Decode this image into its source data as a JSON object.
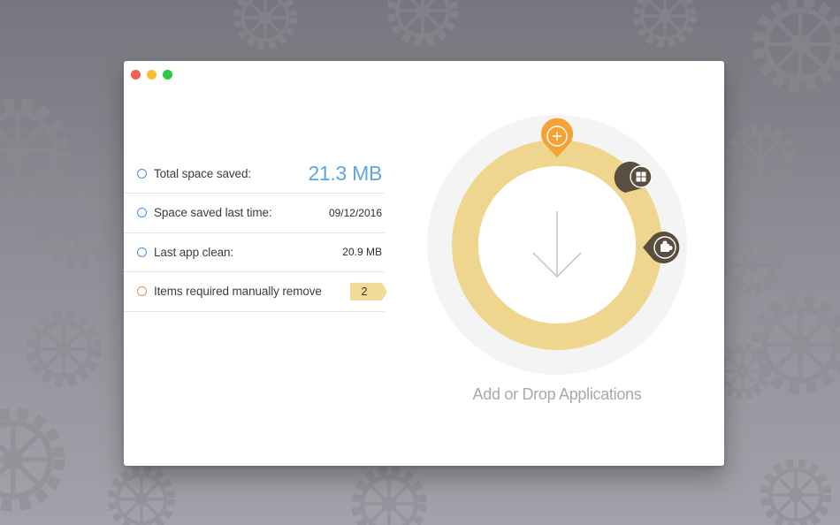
{
  "window": {
    "controls": [
      "close",
      "minimize",
      "maximize"
    ]
  },
  "stats": [
    {
      "label": "Total space saved:",
      "value": "21.3 MB"
    },
    {
      "label": "Space saved last time:",
      "value": "09/12/2016"
    },
    {
      "label": "Last app clean:",
      "value": "20.9 MB"
    },
    {
      "label": "Items required manually remove",
      "value": "2"
    }
  ],
  "drop_zone": {
    "label": "Add or Drop Applications",
    "icons": [
      "plus-icon",
      "grid-icon",
      "puzzle-icon",
      "arrow-down-icon"
    ]
  },
  "colors": {
    "ring": "#efd68f",
    "accent_orange": "#f5a133",
    "marker_dark": "#5a4f3f",
    "value_blue": "#5ea6df",
    "dot_blue": "#4a90d6",
    "dot_orange": "#ef8f52",
    "badge": "#f0da97"
  }
}
